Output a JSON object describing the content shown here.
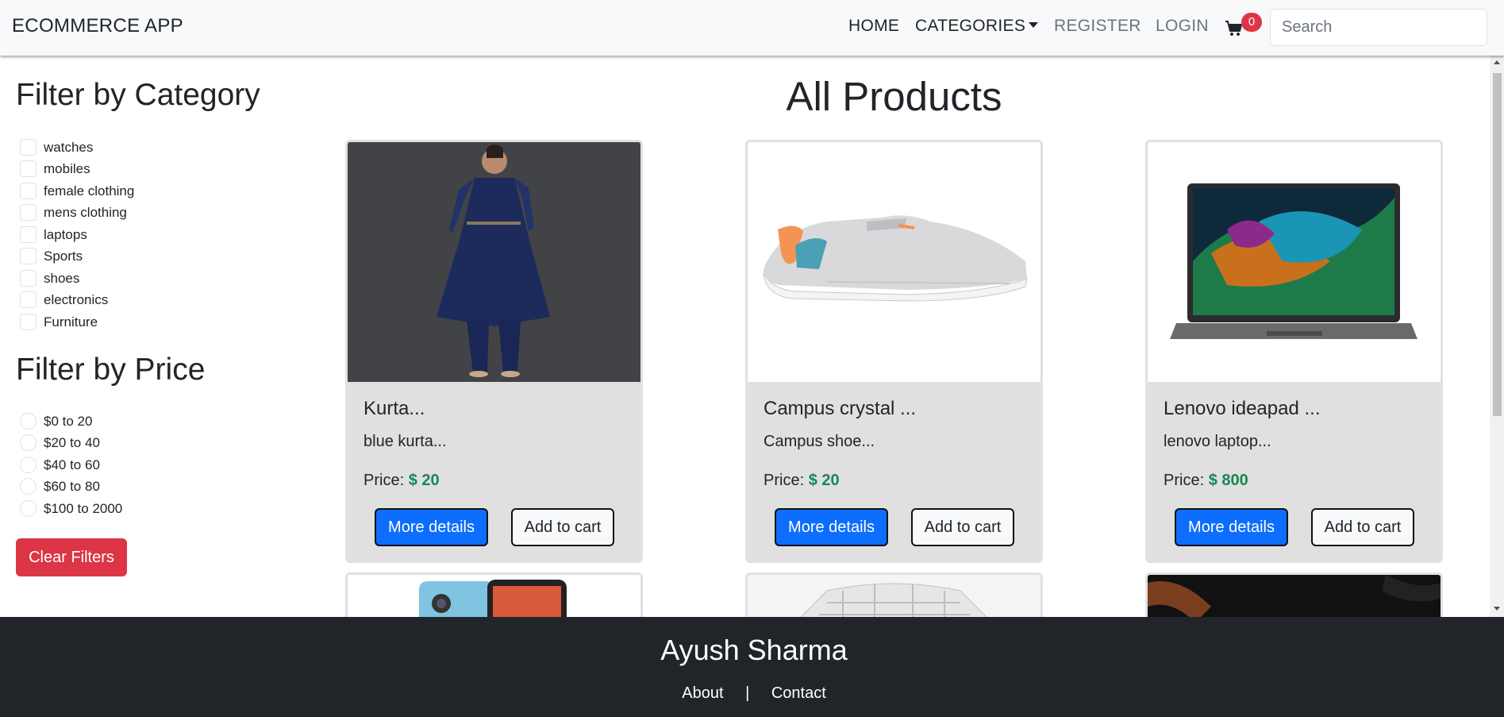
{
  "navbar": {
    "brand": "ECOMMERCE APP",
    "home": "HOME",
    "categories": "CATEGORIES",
    "register": "REGISTER",
    "login": "LOGIN",
    "cart_count": "0",
    "search_placeholder": "Search",
    "search_value": ""
  },
  "sidebar": {
    "category_title": "Filter by Category",
    "categories": [
      "watches",
      "mobiles",
      "female clothing",
      "mens clothing",
      "laptops",
      "Sports",
      "shoes",
      "electronics",
      "Furniture"
    ],
    "price_title": "Filter by Price",
    "prices": [
      "$0 to 20",
      "$20 to 40",
      "$40 to 60",
      "$60 to 80",
      "$100 to 2000"
    ],
    "clear_label": "Clear Filters"
  },
  "main": {
    "title": "All Products",
    "products": [
      {
        "name": "Kurta...",
        "desc": "blue kurta...",
        "price_label": "Price:",
        "price": "$ 20",
        "image_icon": "kurta-image"
      },
      {
        "name": "Campus crystal ...",
        "desc": "Campus shoe...",
        "price_label": "Price:",
        "price": "$ 20",
        "image_icon": "shoe-image"
      },
      {
        "name": "Lenovo ideapad ...",
        "desc": "lenovo laptop...",
        "price_label": "Price:",
        "price": "$ 800",
        "image_icon": "laptop-image"
      }
    ],
    "more_details_label": "More details",
    "add_to_cart_label": "Add to cart"
  },
  "footer": {
    "name": "Ayush Sharma",
    "about": "About",
    "separator": "|",
    "contact": "Contact"
  },
  "colors": {
    "primary": "#0d6efd",
    "danger": "#dc3545",
    "price_green": "#198754",
    "footer_bg": "#212529",
    "card_bg": "#e0e0e0"
  }
}
